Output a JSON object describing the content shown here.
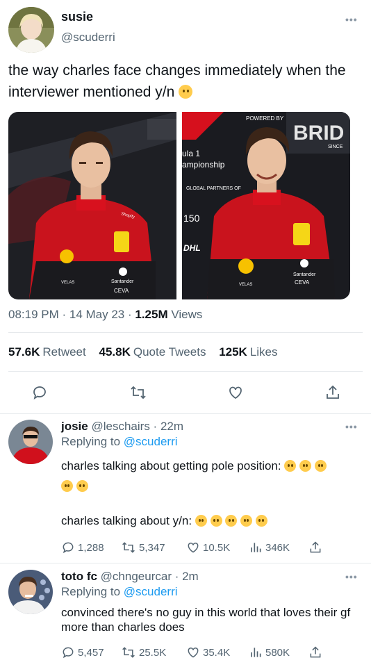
{
  "main_tweet": {
    "author_name": "susie",
    "author_handle": "@scuderri",
    "text": "the way charles face changes immediately when the interviewer mentioned y/n",
    "time": "08:19 PM",
    "date": "14 May 23",
    "views_count": "1.25M",
    "views_label": "Views",
    "retweets_count": "57.6K",
    "retweets_label": "Retweet",
    "quotes_count": "45.8K",
    "quotes_label": "Quote Tweets",
    "likes_count": "125K",
    "likes_label": "Likes",
    "media_left_text": "",
    "media_right_text": {
      "powered": "POWERED BY",
      "hybrid": "BRID",
      "since": "SINCE",
      "formula": "ula 1",
      "championship": "ampionship",
      "partners": "GLOBAL PARTNERS OF",
      "number": "150",
      "dhl": "DHL"
    },
    "suit_text": {
      "sponsor_left": "Santander",
      "ceva": "CEVA",
      "velas": "VELAS",
      "shopify": "Shopify"
    }
  },
  "replies": [
    {
      "author_name": "josie",
      "author_handle": "@leschairs",
      "time": "22m",
      "replying_label": "Replying to",
      "replying_to": "@scuderri",
      "line1": "charles talking about getting pole position:",
      "line2": "charles talking about y/n:",
      "reply_count": "1,288",
      "retweet_count": "5,347",
      "like_count": "10.5K",
      "view_count": "346K"
    },
    {
      "author_name": "toto fc",
      "author_handle": "@chngeurcar",
      "time": "2m",
      "replying_label": "Replying to",
      "replying_to": "@scuderri",
      "text": "convinced there's no guy in this world that loves their gf more than charles does",
      "reply_count": "5,457",
      "retweet_count": "25.5K",
      "like_count": "35.4K",
      "view_count": "580K"
    }
  ],
  "colors": {
    "accent": "#1d9bf0",
    "secondary_text": "#536471",
    "ferrari_red": "#d0101c"
  },
  "icons": [
    "more-icon",
    "reply-icon",
    "retweet-icon",
    "like-icon",
    "share-icon",
    "views-icon"
  ]
}
